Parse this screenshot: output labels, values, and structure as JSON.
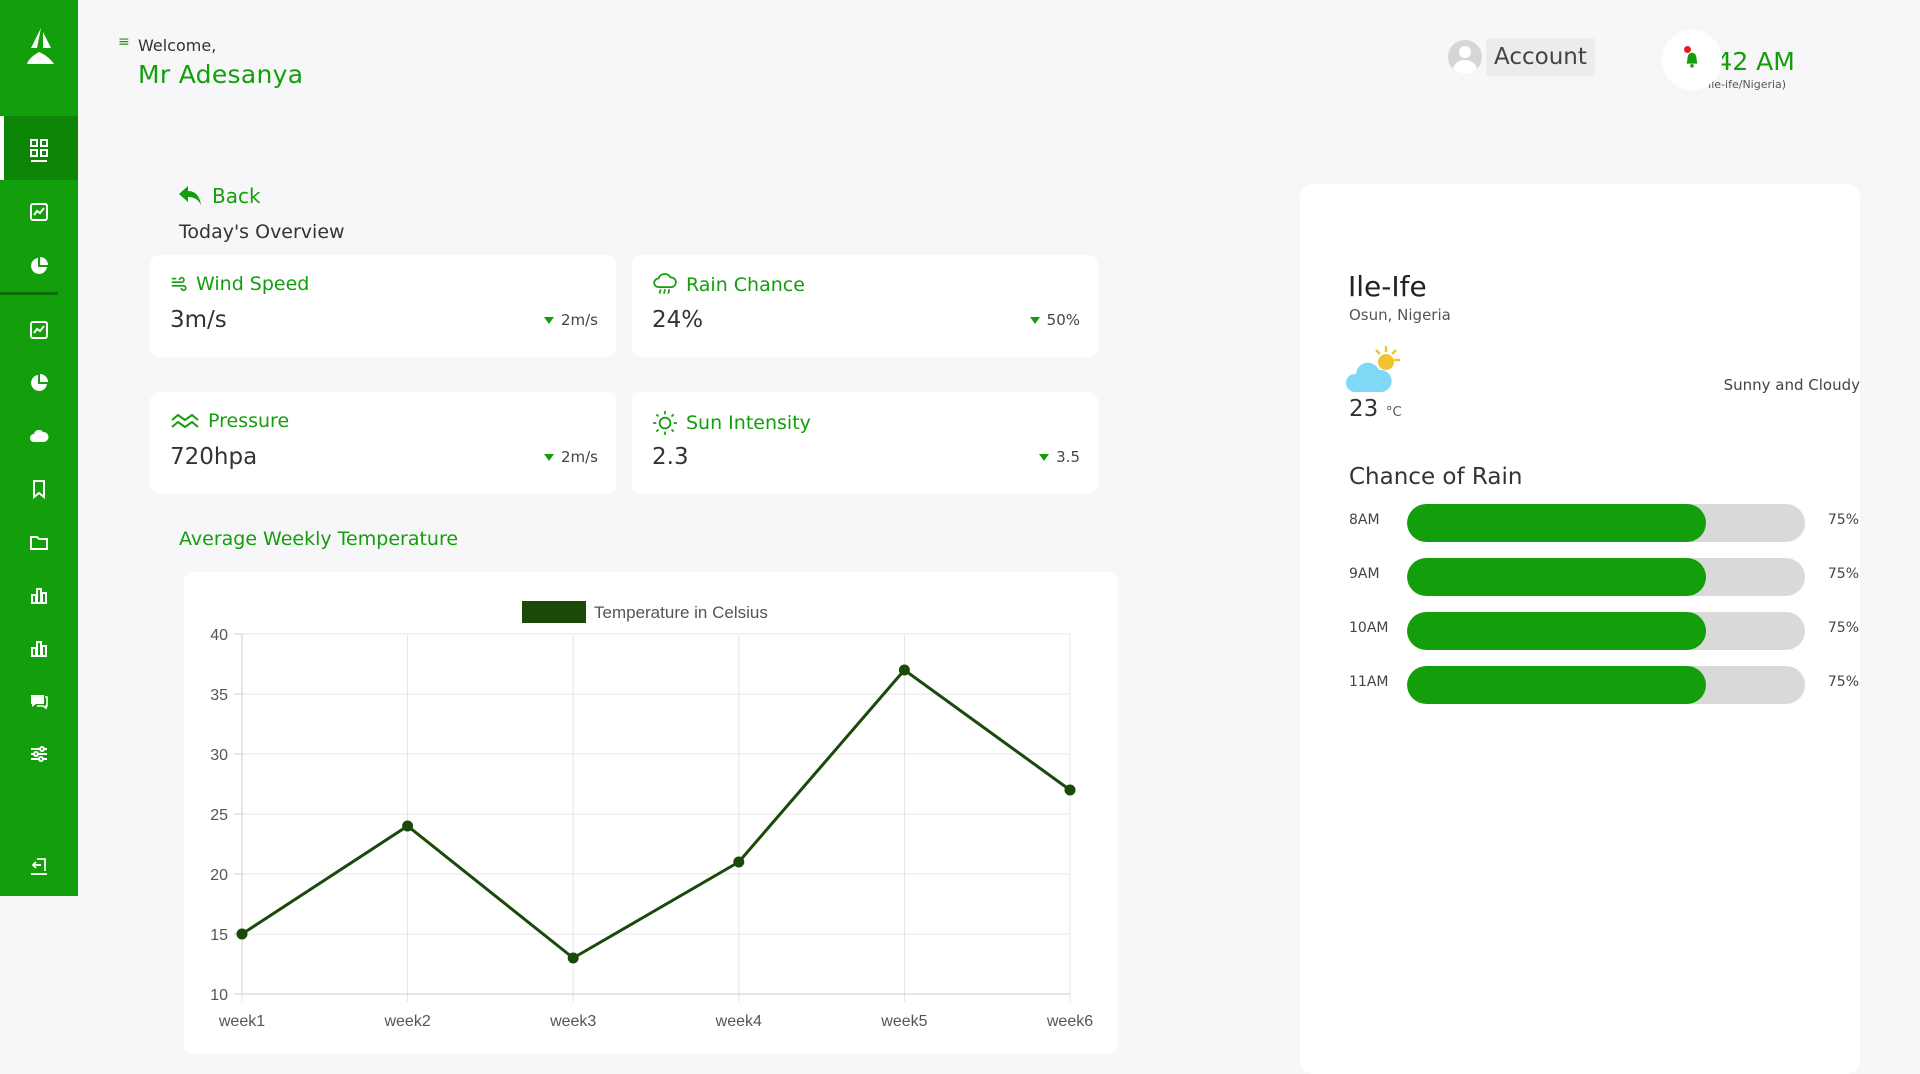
{
  "header": {
    "welcome": "Welcome,",
    "user_name": "Mr Adesanya",
    "account_label": "Account",
    "clock_time": ":42 AM",
    "clock_location": "Ile-ife/Nigeria)"
  },
  "sidebar": {
    "items": [
      {
        "icon": "dashboard-grid-icon",
        "active": true
      },
      {
        "icon": "line-chart-icon"
      },
      {
        "icon": "pie-chart-icon"
      },
      {
        "icon": "line-chart-icon"
      },
      {
        "icon": "pie-chart-icon"
      },
      {
        "icon": "cloud-icon"
      },
      {
        "icon": "bookmark-icon"
      },
      {
        "icon": "folder-icon"
      },
      {
        "icon": "bar-chart-icon"
      },
      {
        "icon": "bar-chart-icon"
      },
      {
        "icon": "chat-icon"
      },
      {
        "icon": "sliders-icon"
      },
      {
        "icon": "logout-icon"
      }
    ]
  },
  "overview": {
    "back_label": "Back",
    "title": "Today's Overview",
    "cards": [
      {
        "title": "Wind Speed",
        "icon": "wind-icon",
        "value": "3m/s",
        "delta": "2m/s"
      },
      {
        "title": "Rain Chance",
        "icon": "rain-cloud-icon",
        "value": "24%",
        "delta": "50%"
      },
      {
        "title": "Pressure",
        "icon": "waves-icon",
        "value": "720hpa",
        "delta": "2m/s"
      },
      {
        "title": "Sun Intensity",
        "icon": "sun-icon",
        "value": "2.3",
        "delta": "3.5"
      }
    ]
  },
  "avg_title": "Average Weekly Temperature",
  "chart_data": {
    "type": "line",
    "x": [
      "week1",
      "week2",
      "week3",
      "week4",
      "week5",
      "week6"
    ],
    "series": [
      {
        "name": "Temperature in Celsius",
        "values": [
          15,
          24,
          13,
          21,
          37,
          27
        ],
        "color": "#1a4a0a"
      }
    ],
    "ylim": [
      10,
      40
    ],
    "yticks": [
      10,
      15,
      20,
      25,
      30,
      35,
      40
    ],
    "grid": true,
    "legend": "top-center"
  },
  "location": {
    "city": "Ile-Ife",
    "region": "Osun, Nigeria",
    "temperature": "23",
    "unit": "°C",
    "condition": "Sunny and Cloudy",
    "icon": "sun-cloud-icon"
  },
  "rain_chance": {
    "title": "Chance of Rain",
    "rows": [
      {
        "hour": "8AM",
        "percent": 75,
        "label": "75%"
      },
      {
        "hour": "9AM",
        "percent": 75,
        "label": "75%"
      },
      {
        "hour": "10AM",
        "percent": 75,
        "label": "75%"
      },
      {
        "hour": "11AM",
        "percent": 75,
        "label": "75%"
      }
    ]
  },
  "colors": {
    "brand": "#139e0b",
    "line": "#1a4a0a",
    "track": "#d9d9d9"
  }
}
